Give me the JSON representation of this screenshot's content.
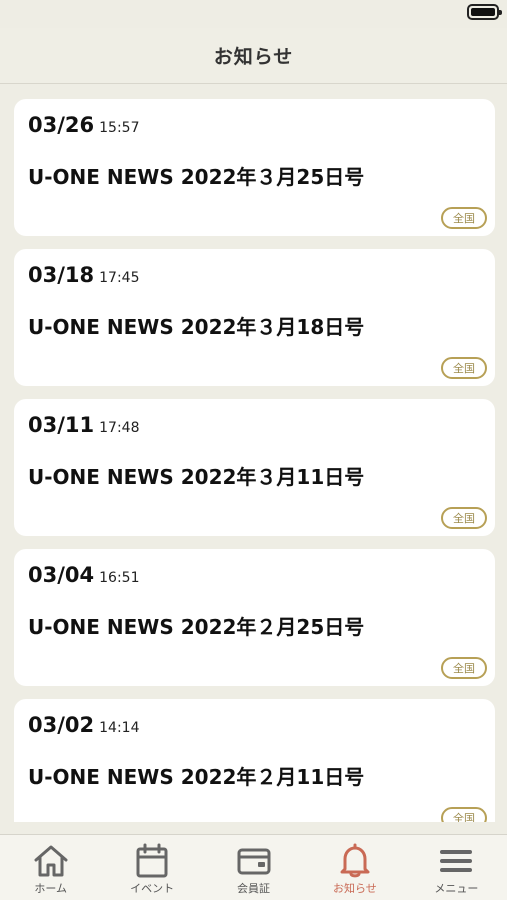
{
  "header": {
    "title": "お知らせ"
  },
  "news": [
    {
      "date": "03/26",
      "time": "15:57",
      "title": "U-ONE NEWS 2022年３月25日号",
      "badge": "全国"
    },
    {
      "date": "03/18",
      "time": "17:45",
      "title": "U-ONE NEWS 2022年３月18日号",
      "badge": "全国"
    },
    {
      "date": "03/11",
      "time": "17:48",
      "title": "U-ONE NEWS 2022年３月11日号",
      "badge": "全国"
    },
    {
      "date": "03/04",
      "time": "16:51",
      "title": "U-ONE NEWS 2022年２月25日号",
      "badge": "全国"
    },
    {
      "date": "03/02",
      "time": "14:14",
      "title": "U-ONE NEWS 2022年２月11日号",
      "badge": "全国"
    }
  ],
  "tabs": [
    {
      "label": "ホーム",
      "icon": "home-icon"
    },
    {
      "label": "イベント",
      "icon": "calendar-icon"
    },
    {
      "label": "会員証",
      "icon": "member-card-icon"
    },
    {
      "label": "お知らせ",
      "icon": "bell-icon",
      "active": true
    },
    {
      "label": "メニュー",
      "icon": "menu-icon"
    }
  ],
  "colors": {
    "background": "#eeede4",
    "accent": "#c96a55",
    "badge": "#b7a056"
  }
}
